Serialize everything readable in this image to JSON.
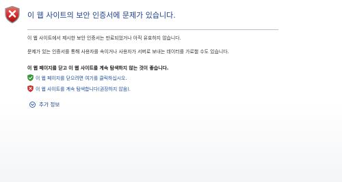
{
  "error_page": {
    "title": "이 웹 사이트의 보안 인증서에 문제가 있습니다.",
    "paragraph_1": "이 웹 사이트에서 제시한 보안 인증서는 만료되었거나 아직 유효하지 않습니다.",
    "paragraph_2": "문제가 있는 인증서를 통해 사용자를 속이거나 사용자가 서버로 보내는 데이터를 가로챌 수도 있습니다.",
    "recommendation": "이 웹 페이지를 닫고 이 웹 사이트를 계속 탐색하지 않는 것이 좋습니다.",
    "close_link": "이 웹 페이지를 닫으려면 여기를 클릭하십시오.",
    "continue_link": "이 웹 사이트를 계속 탐색합니다(권장하지 않음).",
    "more_info": "추가 정보"
  },
  "icons": {
    "header": "shield-error-icon",
    "close_option": "shield-ok-icon",
    "continue_option": "shield-error-icon",
    "more_info": "expand-down-icon"
  },
  "colors": {
    "title": "#1b3f8f",
    "link": "#1b4ea0",
    "shield_red": "#d42a2a",
    "shield_green": "#2f9a2f"
  }
}
